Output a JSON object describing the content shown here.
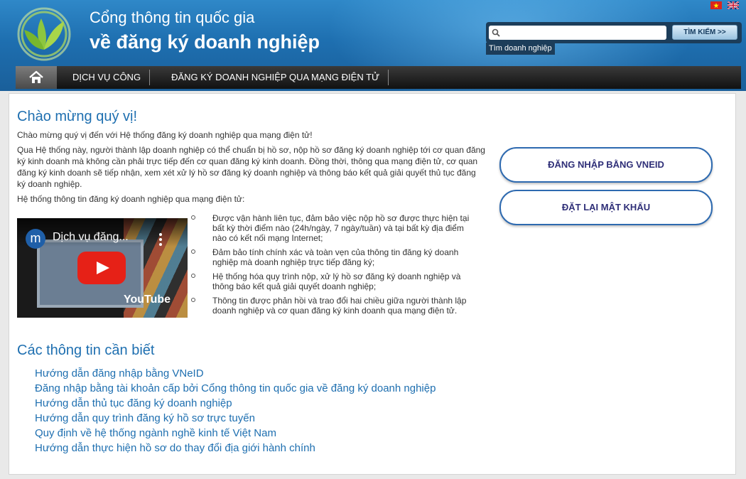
{
  "header": {
    "title_line1": "Cổng thông tin quốc gia",
    "title_line2": "về đăng ký doanh nghiệp",
    "flags": [
      "vietnam-flag-icon",
      "uk-flag-icon"
    ],
    "search": {
      "value": "",
      "button_label": "TÌM KIẾM >>",
      "tooltip": "Tìm doanh nghiệp"
    }
  },
  "nav": {
    "home_icon": "home-icon",
    "items": [
      "DỊCH VỤ CÔNG",
      "ĐĂNG KÝ DOANH NGHIỆP QUA MẠNG ĐIỆN TỬ"
    ]
  },
  "main": {
    "welcome_heading": "Chào mừng quý vị!",
    "intro1": "Chào mừng quý vị đến với Hệ thống đăng ký doanh nghiệp qua mạng điện tử!",
    "intro2": "Qua Hệ thống này, người thành lập doanh nghiệp có thể chuẩn bị hồ sơ, nộp hồ sơ đăng ký doanh nghiệp tới cơ quan đăng ký kinh doanh mà không cần phải trực tiếp đến cơ quan đăng ký kinh doanh. Đồng thời, thông qua mạng điện tử, cơ quan đăng ký kinh doanh sẽ tiếp nhận, xem xét xử lý hồ sơ đăng ký doanh nghiệp và thông báo kết quả giải quyết thủ tục đăng ký doanh nghiệp.",
    "intro3": "Hệ thống thông tin đăng ký doanh nghiệp qua mạng điện tử:",
    "video": {
      "title": "Dịch vụ đăng...",
      "channel_letter": "m",
      "brand": "YouTube"
    },
    "bullets": [
      "Được vận hành liên tục, đảm bảo việc nộp hồ sơ được thực hiện tại bất kỳ thời điểm nào (24h/ngày, 7 ngày/tuần) và tại bất kỳ địa điểm nào có kết nối mạng Internet;",
      "Đảm bảo tính chính xác và toàn vẹn của thông tin đăng ký doanh nghiệp mà doanh nghiệp trực tiếp đăng ký;",
      "Hệ thống hóa quy trình nộp, xử lý hồ sơ đăng ký doanh nghiệp và thông báo kết quả giải quyết doanh nghiệp;",
      "Thông tin được phản hồi và trao đổi hai chiều giữa người thành lập doanh nghiệp và cơ quan đăng ký kinh doanh qua mạng điện tử."
    ],
    "info_heading": "Các thông tin cần biết",
    "links": [
      "Hướng dẫn đăng nhập bằng VNeID",
      "Đăng nhập bằng tài khoản cấp bởi Cổng thông tin quốc gia về đăng ký doanh nghiệp",
      "Hướng dẫn thủ tục đăng ký doanh nghiệp",
      "Hướng dẫn quy trình đăng ký hồ sơ trực tuyến",
      "Quy định về hệ thống ngành nghề kinh tế Việt Nam",
      "Hướng dẫn thực hiện hồ sơ do thay đổi địa giới hành chính"
    ]
  },
  "sidebar": {
    "login_vneid_label": "ĐĂNG NHẬP BẰNG VNEID",
    "reset_password_label": "ĐẶT LẠI MẬT KHẨU"
  },
  "colors": {
    "header_blue": "#1e6fb0",
    "link_blue": "#1e6fb0",
    "button_text": "#2f2f78",
    "youtube_red": "#e62117"
  }
}
